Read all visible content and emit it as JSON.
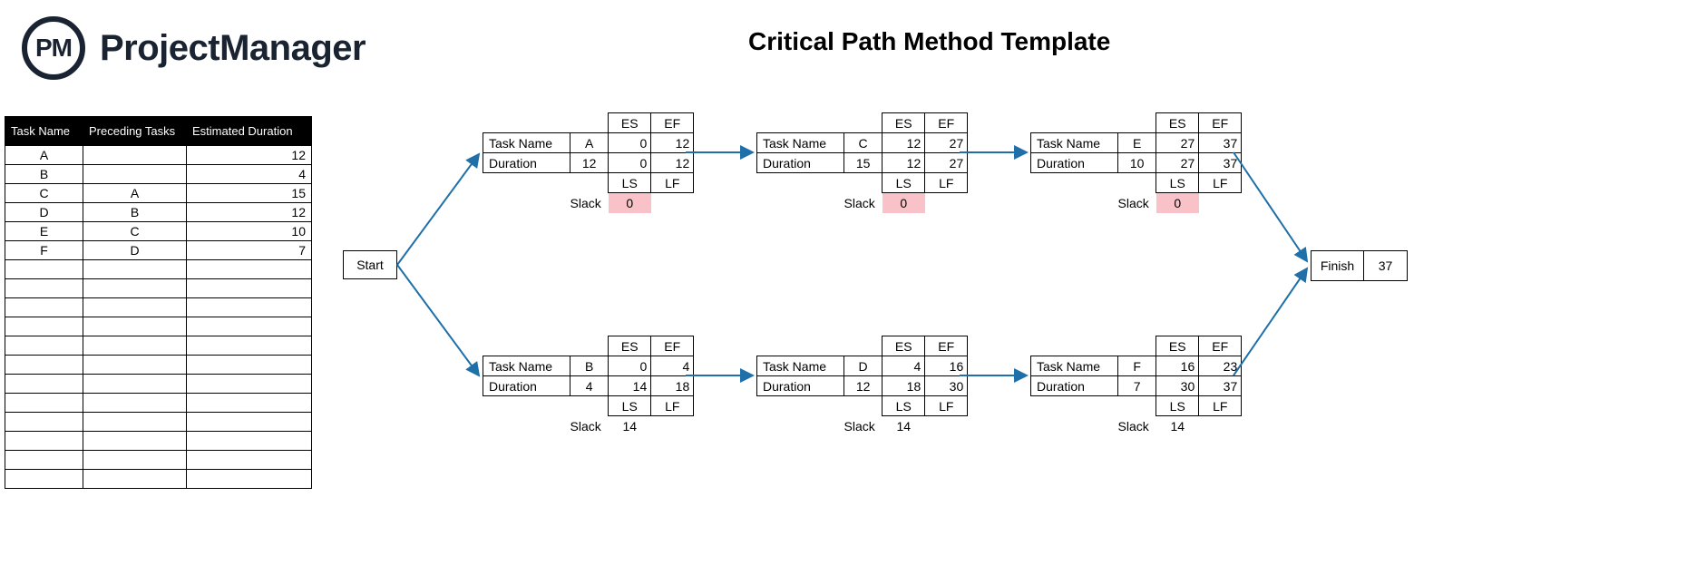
{
  "brand": "ProjectManager",
  "logo_text": "PM",
  "title": "Critical Path Method Template",
  "table": {
    "headers": [
      "Task Name",
      "Preceding Tasks",
      "Estimated Duration"
    ],
    "rows": [
      {
        "name": "A",
        "pred": "",
        "dur": "12"
      },
      {
        "name": "B",
        "pred": "",
        "dur": "4"
      },
      {
        "name": "C",
        "pred": "A",
        "dur": "15"
      },
      {
        "name": "D",
        "pred": "B",
        "dur": "12"
      },
      {
        "name": "E",
        "pred": "C",
        "dur": "10"
      },
      {
        "name": "F",
        "pred": "D",
        "dur": "7"
      }
    ]
  },
  "start_label": "Start",
  "finish": {
    "label": "Finish",
    "value": "37"
  },
  "node_labels": {
    "task_name": "Task Name",
    "duration": "Duration",
    "es": "ES",
    "ef": "EF",
    "ls": "LS",
    "lf": "LF",
    "slack": "Slack"
  },
  "nodes": {
    "A": {
      "id": "A",
      "dur": "12",
      "es": "0",
      "ef": "12",
      "ls": "0",
      "lf": "12",
      "slack": "0",
      "critical": true
    },
    "C": {
      "id": "C",
      "dur": "15",
      "es": "12",
      "ef": "27",
      "ls": "12",
      "lf": "27",
      "slack": "0",
      "critical": true
    },
    "E": {
      "id": "E",
      "dur": "10",
      "es": "27",
      "ef": "37",
      "ls": "27",
      "lf": "37",
      "slack": "0",
      "critical": true
    },
    "B": {
      "id": "B",
      "dur": "4",
      "es": "0",
      "ef": "4",
      "ls": "14",
      "lf": "18",
      "slack": "14",
      "critical": false
    },
    "D": {
      "id": "D",
      "dur": "12",
      "es": "4",
      "ef": "16",
      "ls": "18",
      "lf": "30",
      "slack": "14",
      "critical": false
    },
    "F": {
      "id": "F",
      "dur": "7",
      "es": "16",
      "ef": "23",
      "ls": "30",
      "lf": "37",
      "slack": "14",
      "critical": false
    }
  },
  "chart_data": {
    "type": "table",
    "description": "Critical Path Method network diagram",
    "tasks": [
      {
        "name": "A",
        "duration": 12,
        "predecessors": [],
        "ES": 0,
        "EF": 12,
        "LS": 0,
        "LF": 12,
        "slack": 0,
        "critical": true
      },
      {
        "name": "B",
        "duration": 4,
        "predecessors": [],
        "ES": 0,
        "EF": 4,
        "LS": 14,
        "LF": 18,
        "slack": 14,
        "critical": false
      },
      {
        "name": "C",
        "duration": 15,
        "predecessors": [
          "A"
        ],
        "ES": 12,
        "EF": 27,
        "LS": 12,
        "LF": 27,
        "slack": 0,
        "critical": true
      },
      {
        "name": "D",
        "duration": 12,
        "predecessors": [
          "B"
        ],
        "ES": 4,
        "EF": 16,
        "LS": 18,
        "LF": 30,
        "slack": 14,
        "critical": false
      },
      {
        "name": "E",
        "duration": 10,
        "predecessors": [
          "C"
        ],
        "ES": 27,
        "EF": 37,
        "LS": 27,
        "LF": 37,
        "slack": 0,
        "critical": true
      },
      {
        "name": "F",
        "duration": 7,
        "predecessors": [
          "D"
        ],
        "ES": 16,
        "EF": 23,
        "LS": 30,
        "LF": 37,
        "slack": 14,
        "critical": false
      }
    ],
    "project_finish": 37,
    "critical_path": [
      "A",
      "C",
      "E"
    ]
  }
}
